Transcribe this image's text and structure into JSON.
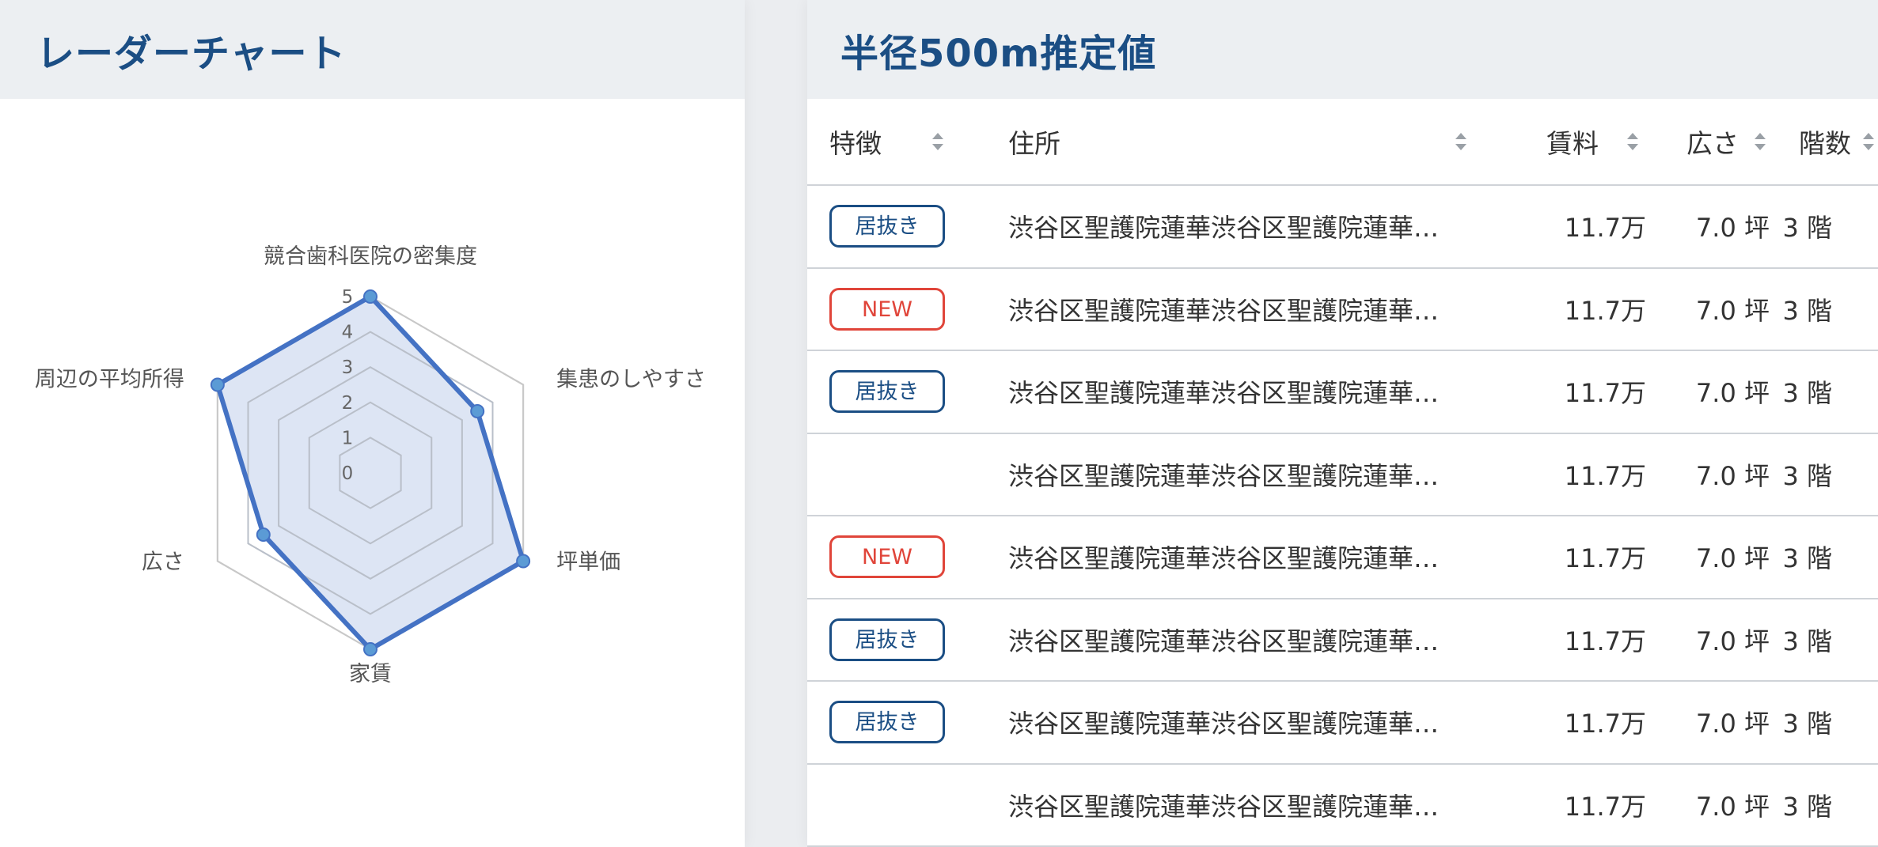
{
  "radar_panel": {
    "title": "レーダーチャート"
  },
  "table_panel": {
    "title": "半径500m推定値",
    "columns": [
      "特徴",
      "住所",
      "賃料",
      "広さ",
      "階数"
    ],
    "badges": {
      "inuki": {
        "label": "居抜き",
        "color": "#1b4e84"
      },
      "new": {
        "label": "NEW",
        "color": "#e0453a"
      }
    },
    "rows": [
      {
        "feature": "居抜き",
        "feature_type": "inuki",
        "address": "渋谷区聖護院蓮華渋谷区聖護院蓮華…",
        "rent": "11.7万",
        "area": "7.0 坪",
        "floor": "3 階"
      },
      {
        "feature": "NEW",
        "feature_type": "new",
        "address": "渋谷区聖護院蓮華渋谷区聖護院蓮華…",
        "rent": "11.7万",
        "area": "7.0 坪",
        "floor": "3 階"
      },
      {
        "feature": "居抜き",
        "feature_type": "inuki",
        "address": "渋谷区聖護院蓮華渋谷区聖護院蓮華…",
        "rent": "11.7万",
        "area": "7.0 坪",
        "floor": "3 階"
      },
      {
        "feature": "",
        "feature_type": "",
        "address": "渋谷区聖護院蓮華渋谷区聖護院蓮華…",
        "rent": "11.7万",
        "area": "7.0 坪",
        "floor": "3 階"
      },
      {
        "feature": "NEW",
        "feature_type": "new",
        "address": "渋谷区聖護院蓮華渋谷区聖護院蓮華…",
        "rent": "11.7万",
        "area": "7.0 坪",
        "floor": "3 階"
      },
      {
        "feature": "居抜き",
        "feature_type": "inuki",
        "address": "渋谷区聖護院蓮華渋谷区聖護院蓮華…",
        "rent": "11.7万",
        "area": "7.0 坪",
        "floor": "3 階"
      },
      {
        "feature": "居抜き",
        "feature_type": "inuki",
        "address": "渋谷区聖護院蓮華渋谷区聖護院蓮華…",
        "rent": "11.7万",
        "area": "7.0 坪",
        "floor": "3 階"
      },
      {
        "feature": "",
        "feature_type": "",
        "address": "渋谷区聖護院蓮華渋谷区聖護院蓮華…",
        "rent": "11.7万",
        "area": "7.0 坪",
        "floor": "3 階"
      }
    ]
  },
  "chart_data": {
    "type": "radar",
    "axes": [
      "競合歯科医院の密集度",
      "集患のしやすさ",
      "坪単価",
      "家賃",
      "広さ",
      "周辺の平均所得"
    ],
    "ticks": [
      "0",
      "1",
      "2",
      "3",
      "4",
      "5"
    ],
    "range": [
      0,
      5
    ],
    "values": [
      5,
      3.5,
      5,
      5,
      3.5,
      5
    ],
    "line_color": "#4472c4",
    "fill_color": "#d9e2f3",
    "point_color": "#5b9bd5",
    "grid_color": "#c8c8c8"
  }
}
